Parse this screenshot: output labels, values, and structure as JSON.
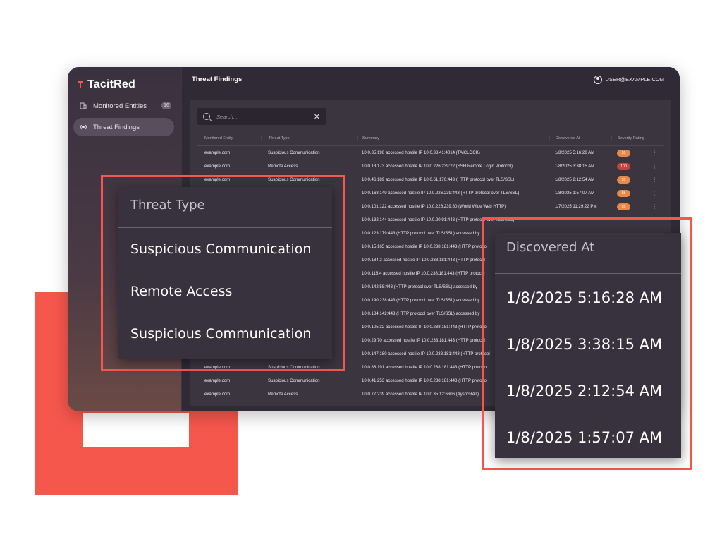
{
  "brand": {
    "name": "TacitRed"
  },
  "sidebar": {
    "items": [
      {
        "label": "Monitored Entities",
        "badge": "16",
        "icon": "building-icon"
      },
      {
        "label": "Threat Findings",
        "icon": "broadcast-icon"
      }
    ]
  },
  "header": {
    "title": "Threat Findings",
    "user": "USER@EXAMPLE.COM"
  },
  "search": {
    "placeholder": "Search..."
  },
  "table": {
    "columns": [
      "Monitored Entity",
      "Threat Type",
      "Summary",
      "Discovered At",
      "Severity Rating"
    ],
    "rows": [
      {
        "entity": "example.com",
        "type": "Suspicious Communication",
        "summary": "10.0.35.196 accessed hostile IP 10.0.38.41:4014 (TAICLOCK)",
        "discovered": "1/8/2025 5:16:28 AM",
        "severity": "55"
      },
      {
        "entity": "example.com",
        "type": "Remote Access",
        "summary": "10.0.13.173 accessed hostile IP 10.0.226.239:22 (SSH Remote Login Protocol)",
        "discovered": "1/8/2025 3:38:15 AM",
        "severity": "100"
      },
      {
        "entity": "example.com",
        "type": "Suspicious Communication",
        "summary": "10.0.46.189 accessed hostile IP 10.0.61.176:443 (HTTP protocol over TLS/SSL)",
        "discovered": "1/8/2025 2:12:54 AM",
        "severity": "55"
      },
      {
        "entity": "",
        "type": "",
        "summary": "10.0.168.149 accessed hostile IP 10.0.226.239:443 (HTTP protocol over TLS/SSL)",
        "discovered": "1/8/2025 1:57:07 AM",
        "severity": "55"
      },
      {
        "entity": "",
        "type": "",
        "summary": "10.0.101.122 accessed hostile IP 10.0.226.239:80 (World Wide Web HTTP)",
        "discovered": "1/7/2025 11:29:22 PM",
        "severity": "55"
      },
      {
        "entity": "",
        "type": "",
        "summary": "10.0.132.144 accessed hostile IP 10.0.20.91:443 (HTTP protocol over TLS/SSL)",
        "discovered": "",
        "severity": ""
      },
      {
        "entity": "",
        "type": "",
        "summary": "10.0.123.179:443 (HTTP protocol over TLS/SSL) accessed by",
        "discovered": "",
        "severity": ""
      },
      {
        "entity": "",
        "type": "",
        "summary": "10.0.15.165 accessed hostile IP 10.0.238.181:443 (HTTP protocol",
        "discovered": "",
        "severity": ""
      },
      {
        "entity": "",
        "type": "",
        "summary": "10.0.184.2 accessed hostile IP 10.0.238.181:443 (HTTP protocol",
        "discovered": "",
        "severity": ""
      },
      {
        "entity": "",
        "type": "",
        "summary": "10.0.115.4 accessed hostile IP 10.0.238.181:443 (HTTP protocol",
        "discovered": "",
        "severity": ""
      },
      {
        "entity": "",
        "type": "",
        "summary": "10.0.142.58:443 (HTTP protocol over TLS/SSL) accessed by",
        "discovered": "",
        "severity": ""
      },
      {
        "entity": "",
        "type": "",
        "summary": "10.0.190.238:443 (HTTP protocol over TLS/SSL) accessed by",
        "discovered": "",
        "severity": ""
      },
      {
        "entity": "",
        "type": "",
        "summary": "10.0.184.142:443 (HTTP protocol over TLS/SSL) accessed by",
        "discovered": "",
        "severity": ""
      },
      {
        "entity": "",
        "type": "",
        "summary": "10.0.105.32 accessed hostile IP 10.0.238.181:443 (HTTP protocol",
        "discovered": "",
        "severity": ""
      },
      {
        "entity": "",
        "type": "",
        "summary": "10.0.29.70 accessed hostile IP 10.0.238.181:443 (HTTP protocol",
        "discovered": "",
        "severity": ""
      },
      {
        "entity": "",
        "type": "",
        "summary": "10.0.147.180 accessed hostile IP 10.0.238.181:443 (HTTP protocol",
        "discovered": "",
        "severity": ""
      },
      {
        "entity": "example.com",
        "type": "Suspicious Communication",
        "summary": "10.0.88.191 accessed hostile IP 10.0.238.181:443 (HTTP protocol",
        "discovered": "",
        "severity": ""
      },
      {
        "entity": "example.com",
        "type": "Suspicious Communication",
        "summary": "10.0.41.253 accessed hostile IP 10.0.238.181:443 (HTTP protocol",
        "discovered": "",
        "severity": ""
      },
      {
        "entity": "example.com",
        "type": "Remote Access",
        "summary": "10.0.77.239 accessed hostile IP 10.0.35.12:6606 (AysncRAT)",
        "discovered": "",
        "severity": ""
      }
    ]
  },
  "callout_threat_type": {
    "header": "Threat Type",
    "items": [
      "Suspicious Communication",
      "Remote Access",
      "Suspicious Communication"
    ]
  },
  "callout_discovered_at": {
    "header": "Discovered At",
    "items": [
      "1/8/2025 5:16:28 AM",
      "1/8/2025 3:38:15 AM",
      "1/8/2025 2:12:54 AM",
      "1/8/2025 1:57:07 AM"
    ]
  },
  "colors": {
    "accent": "#f6574d",
    "severity_medium": "#e8894a",
    "severity_high": "#c94040",
    "app_background": "#2f2a35"
  }
}
